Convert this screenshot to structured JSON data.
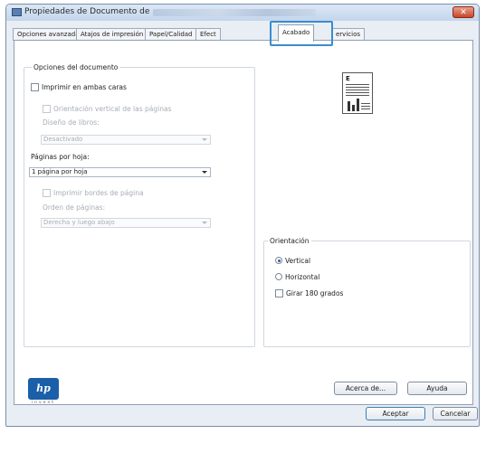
{
  "window": {
    "title": "Propiedades de Documento de",
    "close_label": "✕"
  },
  "tabs": [
    {
      "label": "Opciones avanzadas"
    },
    {
      "label": "Atajos de impresión"
    },
    {
      "label": "Papel/Calidad"
    },
    {
      "label": "Efect"
    },
    {
      "label": "Acabado"
    },
    {
      "label": "ervicios"
    }
  ],
  "document_options": {
    "legend": "Opciones del documento",
    "print_both_sides": "Imprimir en ambas caras",
    "flip_pages_up": "Orientación vertical de las páginas",
    "booklet_layout_label": "Diseño de libros:",
    "booklet_layout_value": "Desactivado",
    "pages_per_sheet_label": "Páginas por hoja:",
    "pages_per_sheet_value": "1 página por hoja",
    "print_page_borders": "Imprimir bordes de página",
    "page_order_label": "Orden de páginas:",
    "page_order_value": "Derecha y luego abajo"
  },
  "orientation": {
    "legend": "Orientación",
    "vertical": "Vertical",
    "horizontal": "Horizontal",
    "rotate_180": "Girar 180 grados",
    "selected": "Vertical"
  },
  "buttons": {
    "about": "Acerca de...",
    "help": "Ayuda",
    "ok": "Aceptar",
    "cancel": "Cancelar"
  },
  "brand": {
    "logo_text": "hp",
    "logo_sub": "invent"
  }
}
